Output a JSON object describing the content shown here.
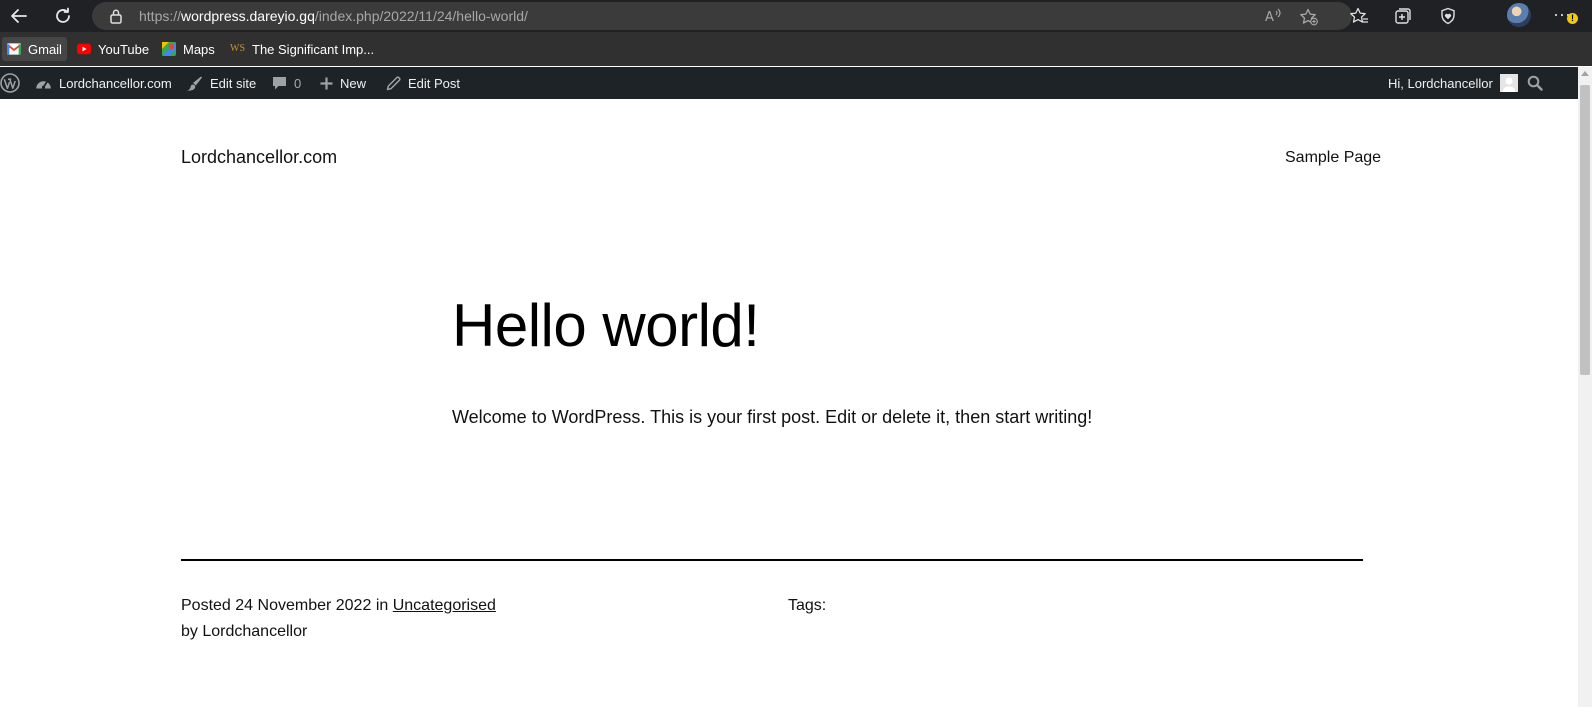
{
  "browser": {
    "url_scheme": "https://",
    "url_host": "wordpress.dareyio.gq",
    "url_path": "/index.php/2022/11/24/hello-world/",
    "more_badge": "!"
  },
  "favorites": [
    {
      "label": "Gmail",
      "icon": "gmail-icon"
    },
    {
      "label": "YouTube",
      "icon": "youtube-icon"
    },
    {
      "label": "Maps",
      "icon": "maps-icon"
    },
    {
      "label": "The Significant Imp...",
      "icon": "ws-icon",
      "icon_text": "WS"
    }
  ],
  "admin_bar": {
    "site_name": "Lordchancellor.com",
    "edit_site": "Edit site",
    "comments_count": "0",
    "new": "New",
    "edit_post": "Edit Post",
    "greeting": "Hi, Lordchancellor"
  },
  "site": {
    "title": "Lordchancellor.com",
    "nav_item": "Sample Page"
  },
  "post": {
    "title": "Hello world!",
    "body": "Welcome to WordPress. This is your first post. Edit or delete it, then start writing!",
    "posted_prefix": "Posted",
    "date": "24 November 2022",
    "in_word": "in",
    "category": "Uncategorised",
    "by_line": "by Lordchancellor",
    "tags_label": "Tags:"
  },
  "colors": {
    "browser_dark": "#202124",
    "favorites_bar": "#303030",
    "admin_bar": "#1d2327",
    "page_bg": "#ffffff"
  }
}
